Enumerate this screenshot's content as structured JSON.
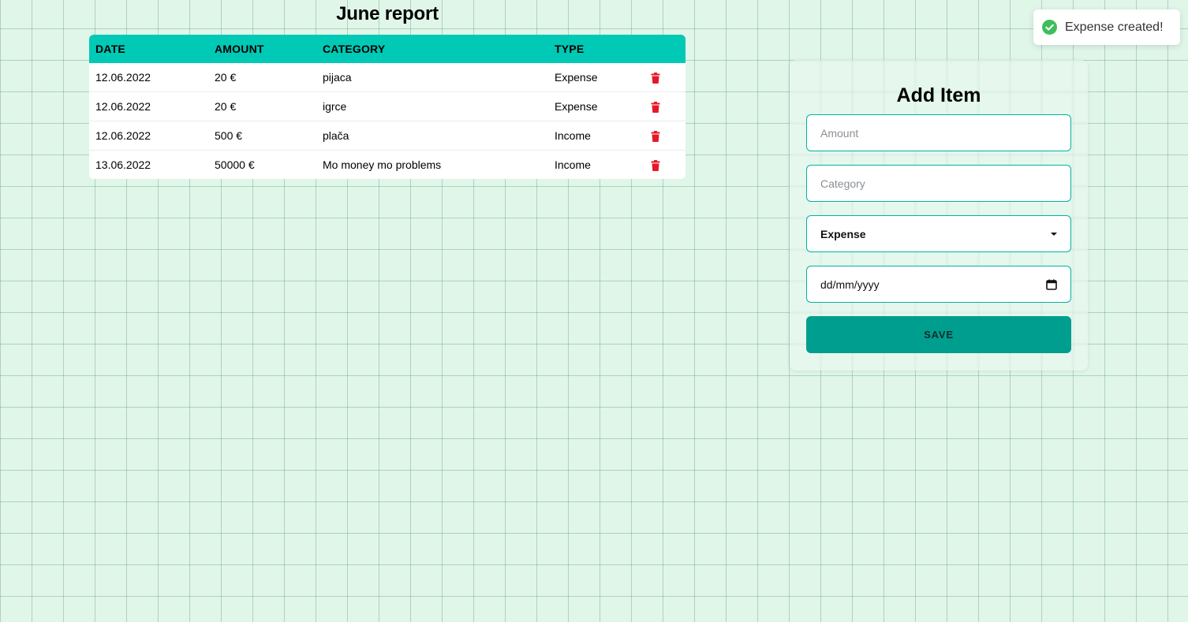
{
  "report": {
    "title": "June report",
    "headers": {
      "date": "DATE",
      "amount": "AMOUNT",
      "category": "CATEGORY",
      "type": "TYPE"
    },
    "rows": [
      {
        "date": "12.06.2022",
        "amount": "20 €",
        "category": "pijaca",
        "type": "Expense"
      },
      {
        "date": "12.06.2022",
        "amount": "20 €",
        "category": "igrce",
        "type": "Expense"
      },
      {
        "date": "12.06.2022",
        "amount": "500 €",
        "category": "plača",
        "type": "Income"
      },
      {
        "date": "13.06.2022",
        "amount": "50000 €",
        "category": "Mo money mo problems",
        "type": "Income"
      }
    ],
    "delete_icon": "trash-icon",
    "delete_color": "#e5182a"
  },
  "form": {
    "title": "Add Item",
    "amount_placeholder": "Amount",
    "category_placeholder": "Category",
    "type_selected": "Expense",
    "date_placeholder": "dd/mm/yyyy",
    "save_label": "SAVE"
  },
  "toast": {
    "message": "Expense created!",
    "icon": "check-circle-icon",
    "icon_color": "#3ebd5c"
  },
  "colors": {
    "accent": "#00c9b5",
    "button": "#009e8e",
    "background": "#dff6e9"
  }
}
